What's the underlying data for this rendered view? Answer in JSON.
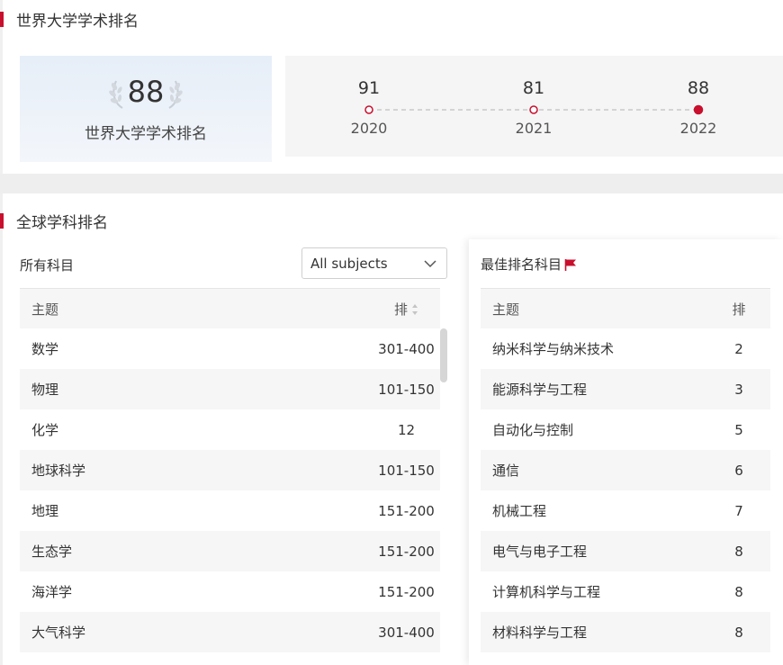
{
  "sections": {
    "world_ranking_title": "世界大学学术排名",
    "subject_ranking_title": "全球学科排名"
  },
  "score_card": {
    "score": "88",
    "label": "世界大学学术排名"
  },
  "timeline": [
    {
      "value": "91",
      "year": "2020"
    },
    {
      "value": "81",
      "year": "2021"
    },
    {
      "value": "88",
      "year": "2022"
    }
  ],
  "filter": {
    "label": "所有科目",
    "selected": "All subjects"
  },
  "left_table": {
    "headers": {
      "subject": "主题",
      "rank": "排"
    },
    "rows": [
      {
        "subject": "数学",
        "rank": "301-400"
      },
      {
        "subject": "物理",
        "rank": "101-150"
      },
      {
        "subject": "化学",
        "rank": "12"
      },
      {
        "subject": "地球科学",
        "rank": "101-150"
      },
      {
        "subject": "地理",
        "rank": "151-200"
      },
      {
        "subject": "生态学",
        "rank": "151-200"
      },
      {
        "subject": "海洋学",
        "rank": "151-200"
      },
      {
        "subject": "大气科学",
        "rank": "301-400"
      }
    ]
  },
  "right_panel": {
    "title": "最佳排名科目",
    "headers": {
      "subject": "主题",
      "rank": "排"
    },
    "rows": [
      {
        "subject": "纳米科学与纳米技术",
        "rank": "2"
      },
      {
        "subject": "能源科学与工程",
        "rank": "3"
      },
      {
        "subject": "自动化与控制",
        "rank": "5"
      },
      {
        "subject": "通信",
        "rank": "6"
      },
      {
        "subject": "机械工程",
        "rank": "7"
      },
      {
        "subject": "电气与电子工程",
        "rank": "8"
      },
      {
        "subject": "计算机科学与工程",
        "rank": "8"
      },
      {
        "subject": "材料科学与工程",
        "rank": "8"
      }
    ]
  },
  "colors": {
    "accent": "#c8102e",
    "row_alt": "#f6f6f6"
  }
}
